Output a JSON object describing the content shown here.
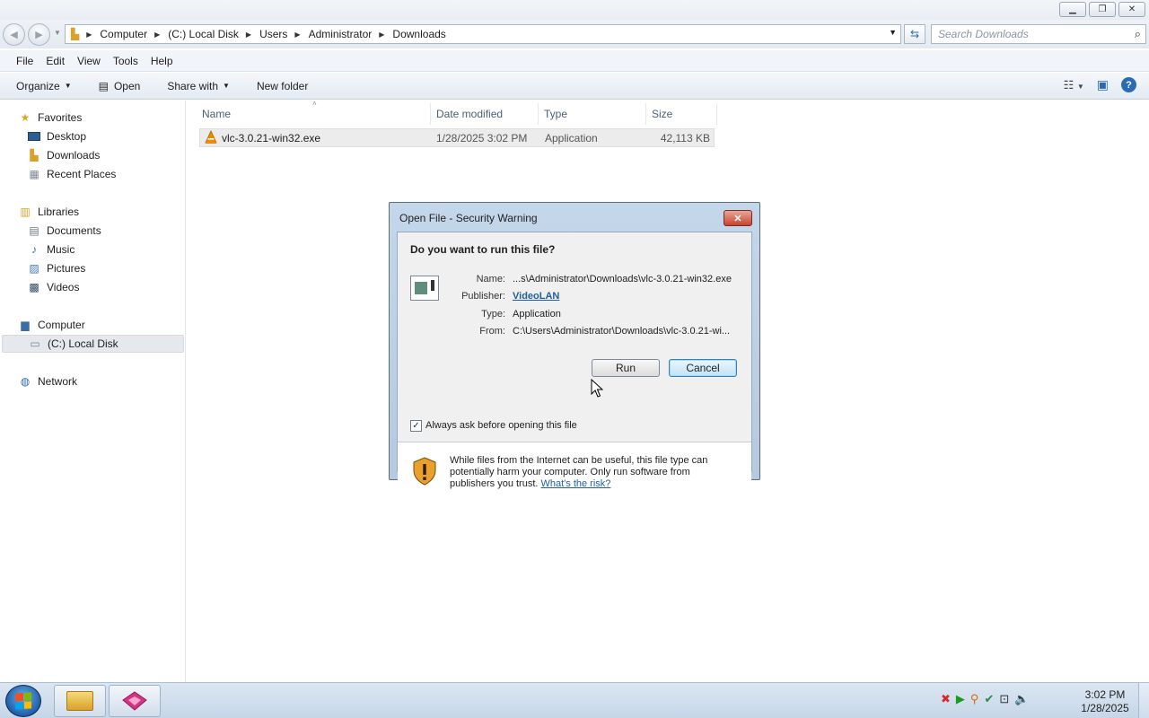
{
  "window": {
    "minimize_icon": "minimize-icon",
    "maximize_icon": "restore-icon",
    "close_label": "✕"
  },
  "address": {
    "segments": [
      "Computer",
      "(C:) Local Disk",
      "Users",
      "Administrator",
      "Downloads"
    ],
    "search_placeholder": "Search Downloads"
  },
  "menu": [
    "File",
    "Edit",
    "View",
    "Tools",
    "Help"
  ],
  "commands": {
    "organize": "Organize",
    "open": "Open",
    "share_with": "Share with",
    "new_folder": "New folder"
  },
  "nav": {
    "favorites": "Favorites",
    "desktop": "Desktop",
    "downloads": "Downloads",
    "recent_places": "Recent Places",
    "libraries": "Libraries",
    "documents": "Documents",
    "music": "Music",
    "pictures": "Pictures",
    "videos": "Videos",
    "computer": "Computer",
    "local_disk": "(C:) Local Disk",
    "network": "Network"
  },
  "columns": {
    "name": "Name",
    "date_modified": "Date modified",
    "type": "Type",
    "size": "Size"
  },
  "files": [
    {
      "name": "vlc-3.0.21-win32.exe",
      "date_modified": "1/28/2025 3:02 PM",
      "type": "Application",
      "size": "42,113 KB"
    }
  ],
  "dialog": {
    "title": "Open File - Security Warning",
    "question": "Do you want to run this file?",
    "name_label": "Name:",
    "name_value": "...s\\Administrator\\Downloads\\vlc-3.0.21-win32.exe",
    "publisher_label": "Publisher:",
    "publisher_value": "VideoLAN",
    "type_label": "Type:",
    "type_value": "Application",
    "from_label": "From:",
    "from_value": "C:\\Users\\Administrator\\Downloads\\vlc-3.0.21-wi...",
    "run_label": "Run",
    "cancel_label": "Cancel",
    "always_ask_label": "Always ask before opening this file",
    "always_ask_checked": true,
    "warning_text": "While files from the Internet can be useful, this file type can potentially harm your computer. Only run software from publishers you trust.",
    "risk_link": "What's the risk?"
  },
  "taskbar": {
    "time": "3:02 PM",
    "date": "1/28/2025"
  },
  "colors": {
    "accent": "#1f5fa9",
    "dialog_frame": "#b5c9e0",
    "close_red": "#c8442f",
    "vlc_orange": "#f08a00"
  }
}
